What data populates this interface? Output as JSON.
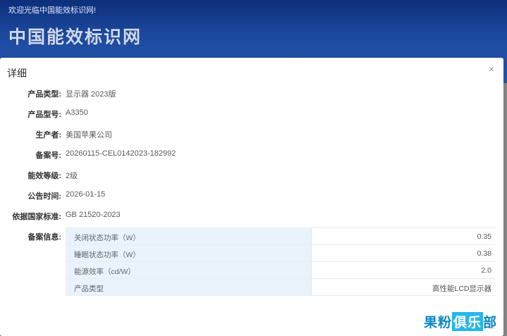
{
  "page": {
    "welcome_text": "欢迎光临中国能效标识网!",
    "site_title": "中国能效标识网"
  },
  "modal": {
    "title": "详细",
    "close_glyph": "×",
    "fields": [
      {
        "label": "产品类型:",
        "value": "显示器 2023版"
      },
      {
        "label": "产品型号:",
        "value": "A3350"
      },
      {
        "label": "生产者:",
        "value": "美国苹果公司"
      },
      {
        "label": "备案号:",
        "value": "20260115-CEL0142023-182992"
      },
      {
        "label": "能效等级:",
        "value": "2级"
      },
      {
        "label": "公告时间:",
        "value": "2026-01-15"
      },
      {
        "label": "依据国家标准:",
        "value": "GB 21520-2023"
      }
    ],
    "filing_label": "备案信息:",
    "filing_table": [
      {
        "key": "关闭状态功率（W）",
        "value": "0.35"
      },
      {
        "key": "睡眠状态功率（W）",
        "value": "0.38"
      },
      {
        "key": "能源效率（cd/W）",
        "value": "2.0"
      },
      {
        "key": "产品类型",
        "value": "高性能LCD显示器"
      }
    ]
  },
  "watermark": {
    "prefix": "果粉",
    "box": "俱乐",
    "suffix": "部"
  }
}
